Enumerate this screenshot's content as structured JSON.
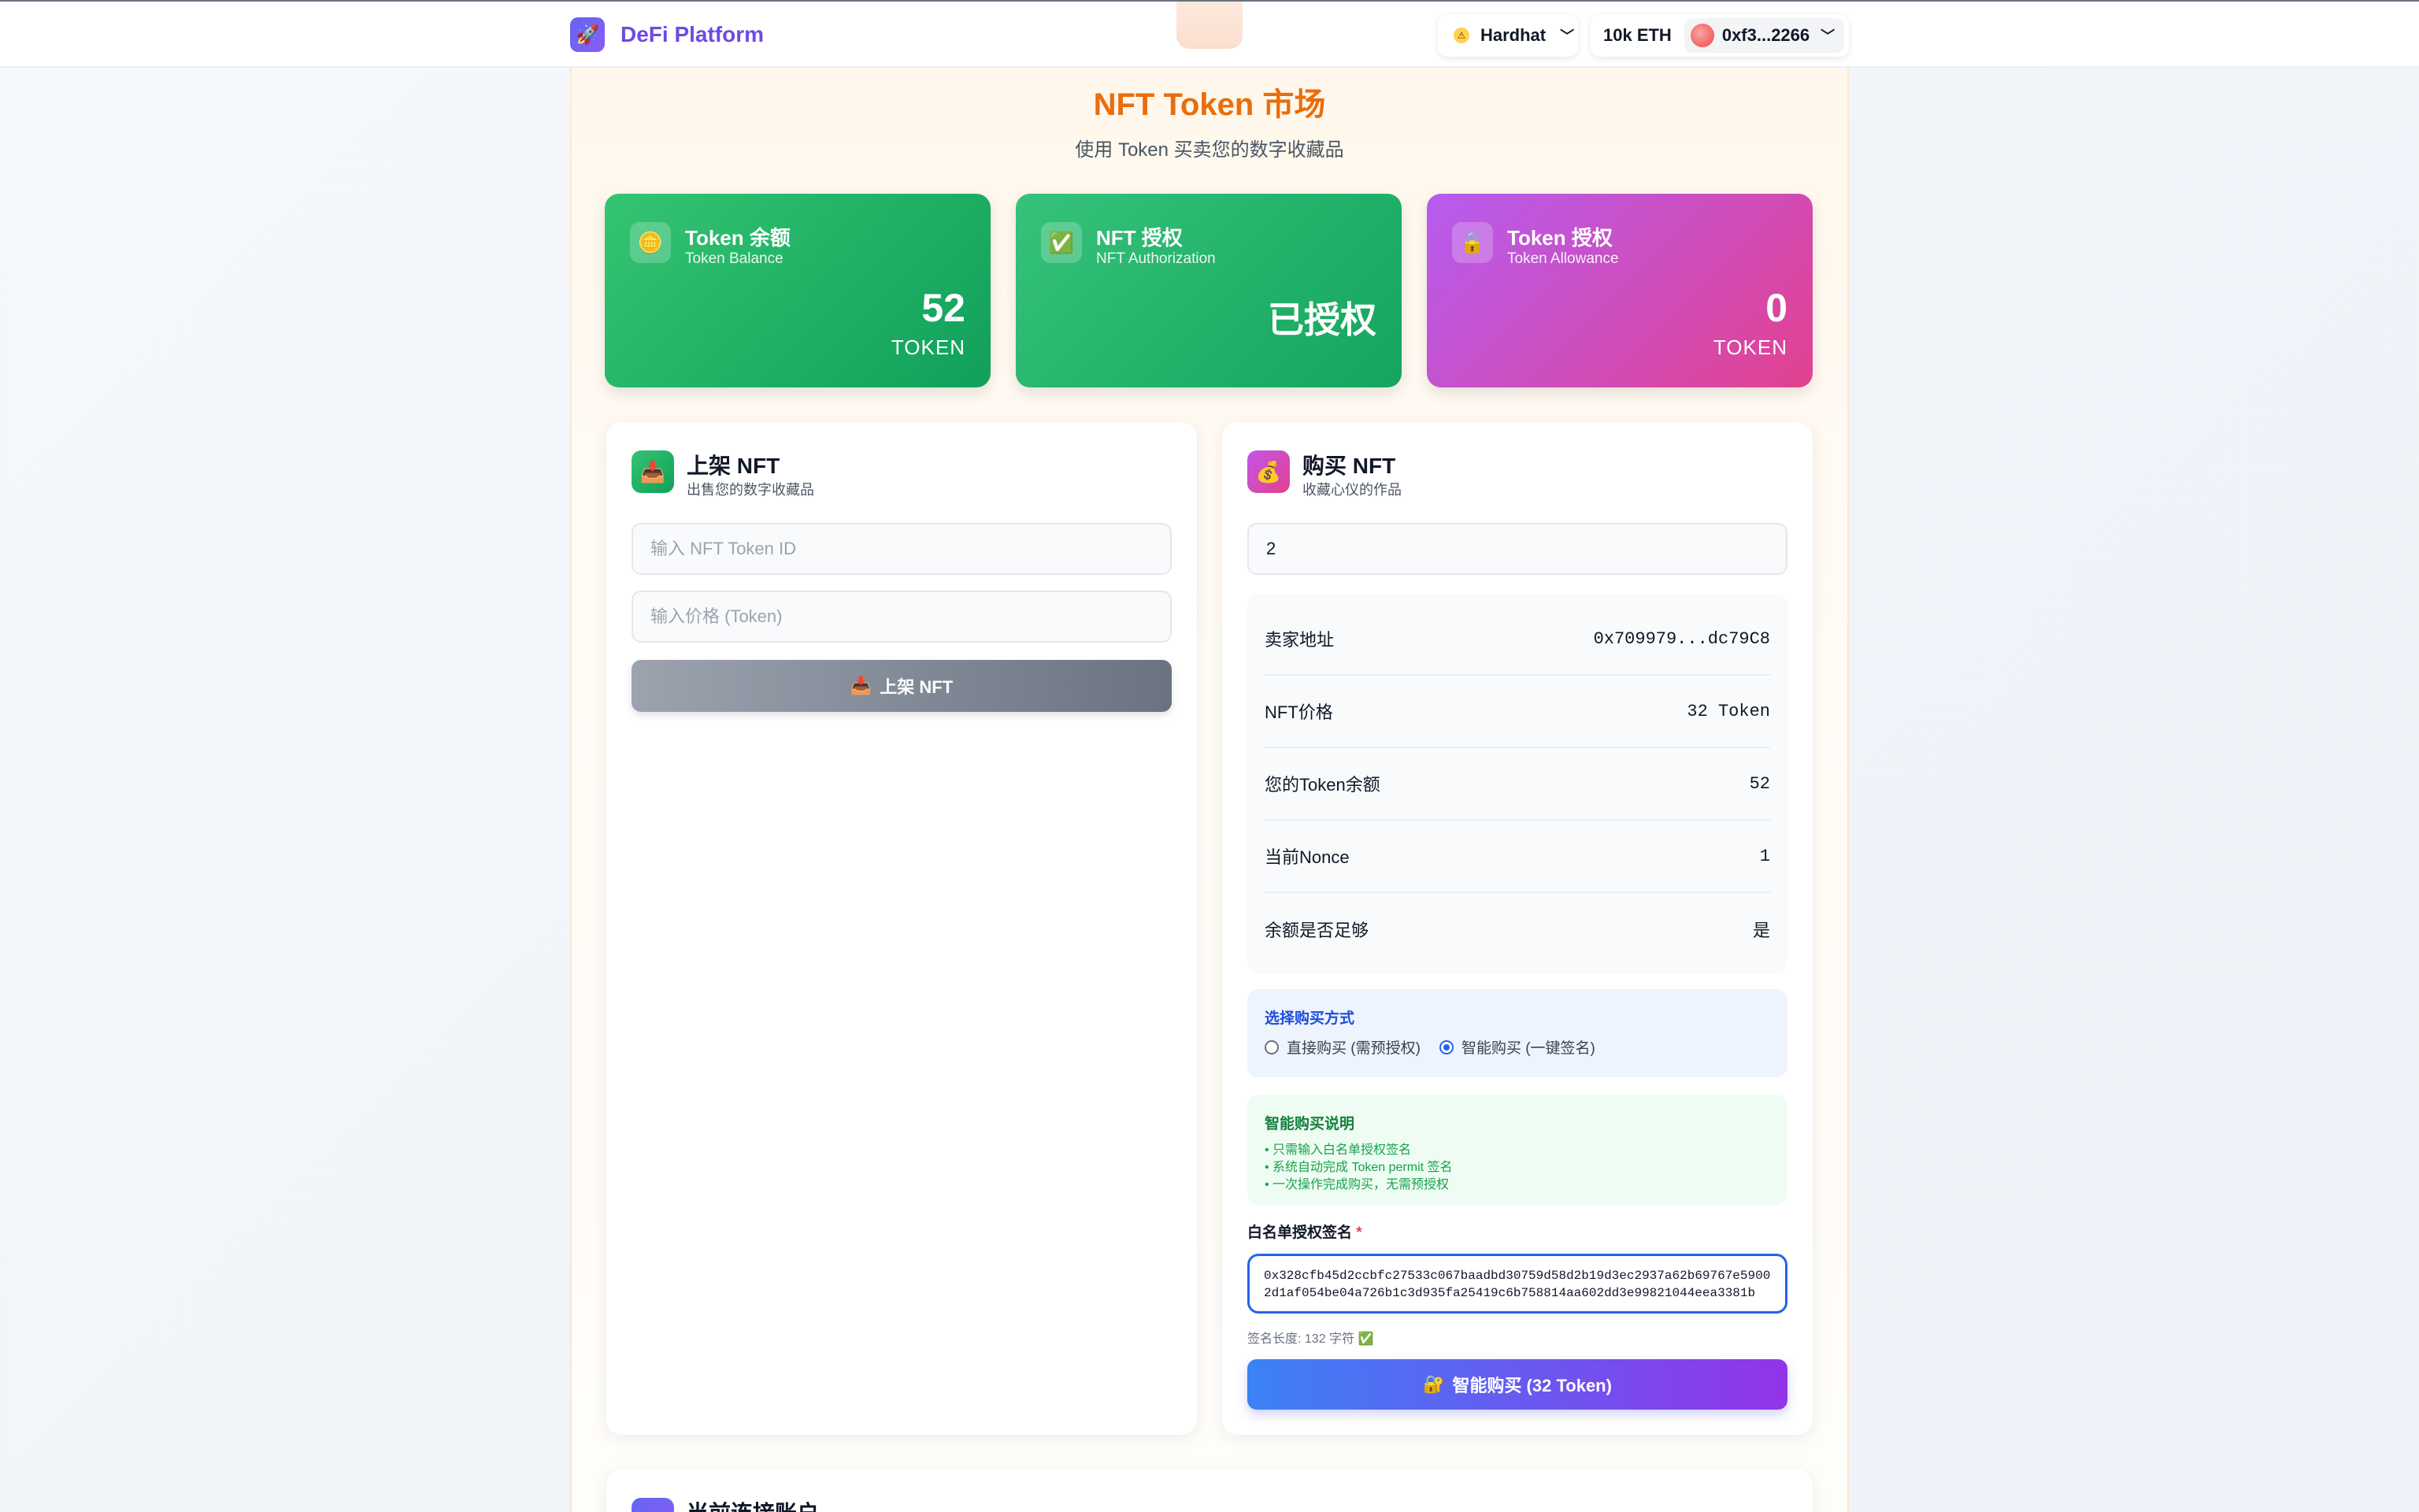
{
  "nav": {
    "brand_icon": "rocket-icon",
    "brand_name": "DeFi Platform",
    "network": "Hardhat",
    "network_icon": "hardhat-icon",
    "balance": "10k ETH",
    "account": "0xf3...2266"
  },
  "header": {
    "title": "NFT Token 市场",
    "subtitle": "使用 Token 买卖您的数字收藏品"
  },
  "stats": [
    {
      "icon": "coin-icon",
      "title": "Token 余额",
      "subtitle": "Token Balance",
      "value": "52",
      "unit": "TOKEN"
    },
    {
      "icon": "check-icon",
      "title": "NFT 授权",
      "subtitle": "NFT Authorization",
      "value": "已授权",
      "unit": ""
    },
    {
      "icon": "lock-icon",
      "title": "Token 授权",
      "subtitle": "Token Allowance",
      "value": "0",
      "unit": "TOKEN"
    }
  ],
  "list_panel": {
    "icon": "inbox-icon",
    "title": "上架 NFT",
    "subtitle": "出售您的数字收藏品",
    "token_id_placeholder": "输入 NFT Token ID",
    "price_placeholder": "输入价格 (Token)",
    "button_label": "上架 NFT"
  },
  "buy_panel": {
    "icon": "money-bag-icon",
    "title": "购买 NFT",
    "subtitle": "收藏心仪的作品",
    "token_id_value": "2",
    "info": [
      {
        "label": "卖家地址",
        "value": "0x709979...dc79C8"
      },
      {
        "label": "NFT价格",
        "value": "32 Token"
      },
      {
        "label": "您的Token余额",
        "value": "52"
      },
      {
        "label": "当前Nonce",
        "value": "1"
      },
      {
        "label": "余额是否足够",
        "value": "是"
      }
    ],
    "method_title": "选择购买方式",
    "method_options": [
      "直接购买 (需预授权)",
      "智能购买 (一键签名)"
    ],
    "method_selected": 1,
    "smart_title": "智能购买说明",
    "smart_items": [
      "• 只需输入白名单授权签名",
      "• 系统自动完成 Token permit 签名",
      "• 一次操作完成购买，无需预授权"
    ],
    "signature_label": "白名单授权签名",
    "signature_required_mark": "*",
    "signature_value": "0x328cfb45d2ccbfc27533c067baadbd30759d58d2b19d3ec2937a62b69767e59002d1af054be04a726b1c3d935fa25419c6b758814aa602dd3e99821044eea3381b",
    "signature_length_text": "签名长度: 132 字符 ✅",
    "buy_button_label": "智能购买 (32 Token)"
  },
  "bottom_panel": {
    "title": "当前连接账户"
  }
}
